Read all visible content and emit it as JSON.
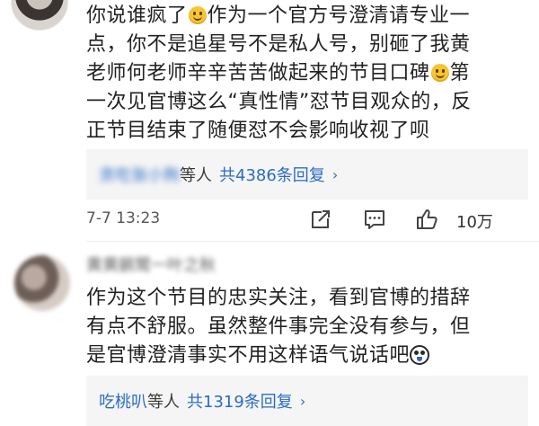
{
  "comment1": {
    "lines": [
      "你说谁疯了",
      "作为一个官方号澄清请专业一",
      "点，你不是追星号不是私人号，别砸了我黄",
      "老师何老师辛辛苦苦做起来的节目口碑",
      "第",
      "一次见官博这么“真性情”怼节目观众的，反",
      "正节目结束了随便怼不会影响收视了呗"
    ],
    "replies": {
      "names": "贪吃张小狗",
      "etc": "等人",
      "total": "共4386条回复",
      "chevron": "›"
    },
    "timestamp": "7-7 13:23",
    "likes": "10万"
  },
  "comment2": {
    "username": "黄黄鹂鹭一叶之秋",
    "lines": [
      "作为这个节目的忠实关注，看到官博的措辞",
      "有点不舒服。虽然整件事完全没有参与，但",
      "是官博澄清事实不用这样语气说话吧"
    ],
    "replies": {
      "names": "吃桃叭",
      "etc": "等人",
      "total": "共1319条回复",
      "chevron": "›"
    }
  },
  "icons": [
    "smile-emoji-icon",
    "dog-emoji-icon",
    "share-icon",
    "comment-icon",
    "like-icon"
  ],
  "colors": {
    "link": "#2b6cc4",
    "reply_bg": "#f5f5f5",
    "emoji": "#f7c531"
  }
}
